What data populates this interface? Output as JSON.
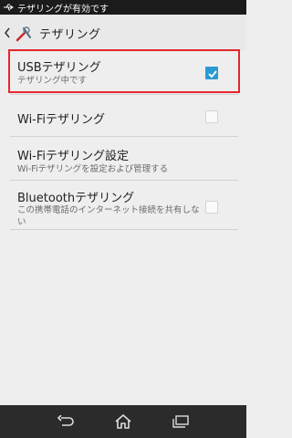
{
  "status_bar": {
    "text": "テザリングが有効です",
    "icon": "usb-icon"
  },
  "action_bar": {
    "title": "テザリング",
    "back_icon": "chevron-left-icon",
    "app_icon": "wrench-tools-icon"
  },
  "items": [
    {
      "title": "USBテザリング",
      "subtitle": "テザリング中です",
      "checkbox": true,
      "checked": true
    },
    {
      "title": "Wi-Fiテザリング",
      "subtitle": "",
      "checkbox": true,
      "checked": false
    },
    {
      "title": "Wi-Fiテザリング設定",
      "subtitle": "Wi-Fiテザリングを設定および管理する",
      "checkbox": false,
      "checked": false
    },
    {
      "title": "Bluetoothテザリング",
      "subtitle": "この携帯電話のインターネット接続を共有しない",
      "checkbox": true,
      "checked": false
    }
  ],
  "nav_bar": {
    "back_icon": "back-icon",
    "home_icon": "home-icon",
    "recents_icon": "recents-icon"
  },
  "colors": {
    "accent": "#2a9bd1",
    "highlight": "#e5262e",
    "background": "#eeeeee"
  }
}
